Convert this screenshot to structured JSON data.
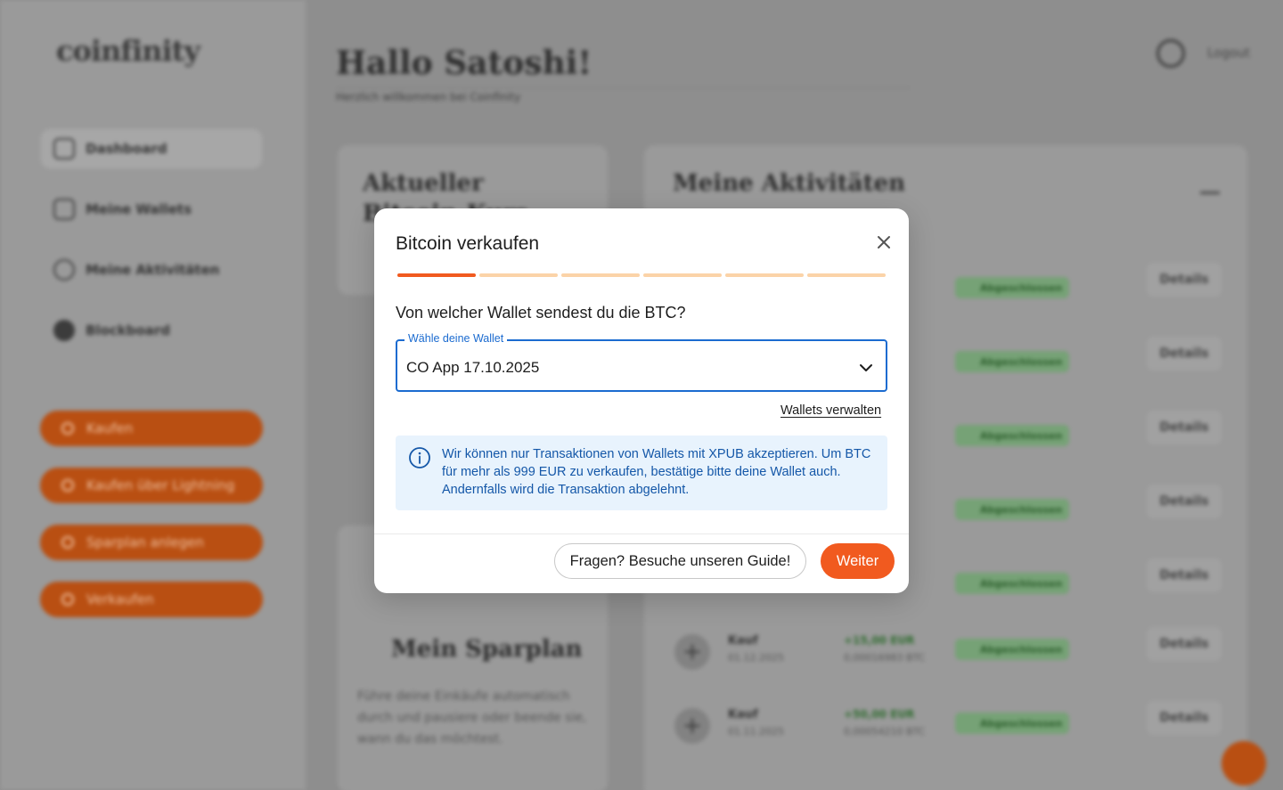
{
  "background": {
    "logo": "coinfinity",
    "sidebar": {
      "items": [
        {
          "label": "Dashboard",
          "icon": "home-icon"
        },
        {
          "label": "Meine Wallets",
          "icon": "wallet-icon"
        },
        {
          "label": "Meine Aktivitäten",
          "icon": "activity-icon"
        },
        {
          "label": "Blockboard",
          "icon": "blockboard-icon"
        }
      ],
      "actions": [
        {
          "label": "Kaufen",
          "icon": "plus-icon"
        },
        {
          "label": "Kaufen über Lightning",
          "icon": "lightning-icon"
        },
        {
          "label": "Sparplan anlegen",
          "icon": "calendar-icon"
        },
        {
          "label": "Verkaufen",
          "icon": "minus-icon"
        }
      ]
    },
    "header": {
      "greeting": "Hallo Satoshi!",
      "subtitle": "Herzlich willkommen bei Coinfinity",
      "logout": "Logout"
    },
    "price_card": {
      "title": "Aktueller Bitcoin-Kurs"
    },
    "savings_card": {
      "title": "Mein Sparplan",
      "text": "Führe deine Einkäufe automatisch durch und pausiere oder beende sie, wann du das möchtest."
    },
    "activity": {
      "title": "Meine Aktivitäten",
      "status_label": "Abgeschlossen",
      "details_label": "Details",
      "rows": [
        {
          "kind": "Kauf",
          "date": "01.12.2025",
          "amount": "+15,00 EUR",
          "btc": "0,00016983 BTC"
        },
        {
          "kind": "Kauf",
          "date": "01.11.2025",
          "amount": "+50,00 EUR",
          "btc": "0,00054210 BTC"
        }
      ]
    }
  },
  "modal": {
    "title": "Bitcoin verkaufen",
    "steps_total": 6,
    "current_step": 1,
    "question": "Von welcher Wallet sendest du die BTC?",
    "wallet_select": {
      "legend": "Wähle deine Wallet",
      "value": "CO App 17.10.2025"
    },
    "manage_link": "Wallets verwalten",
    "info": "Wir können nur Transaktionen von Wallets mit XPUB akzeptieren. Um BTC für mehr als 999 EUR zu verkaufen, bestätige bitte deine Wallet auch. Andernfalls wird die Transaktion abgelehnt.",
    "guide_button": "Fragen? Besuche unseren Guide!",
    "next_button": "Weiter"
  },
  "colors": {
    "accent": "#f15a1f",
    "progress_inactive": "#fbd3a8",
    "select_border": "#1b6bd0",
    "info_bg": "#e8f3fd",
    "info_text": "#1457a8"
  }
}
